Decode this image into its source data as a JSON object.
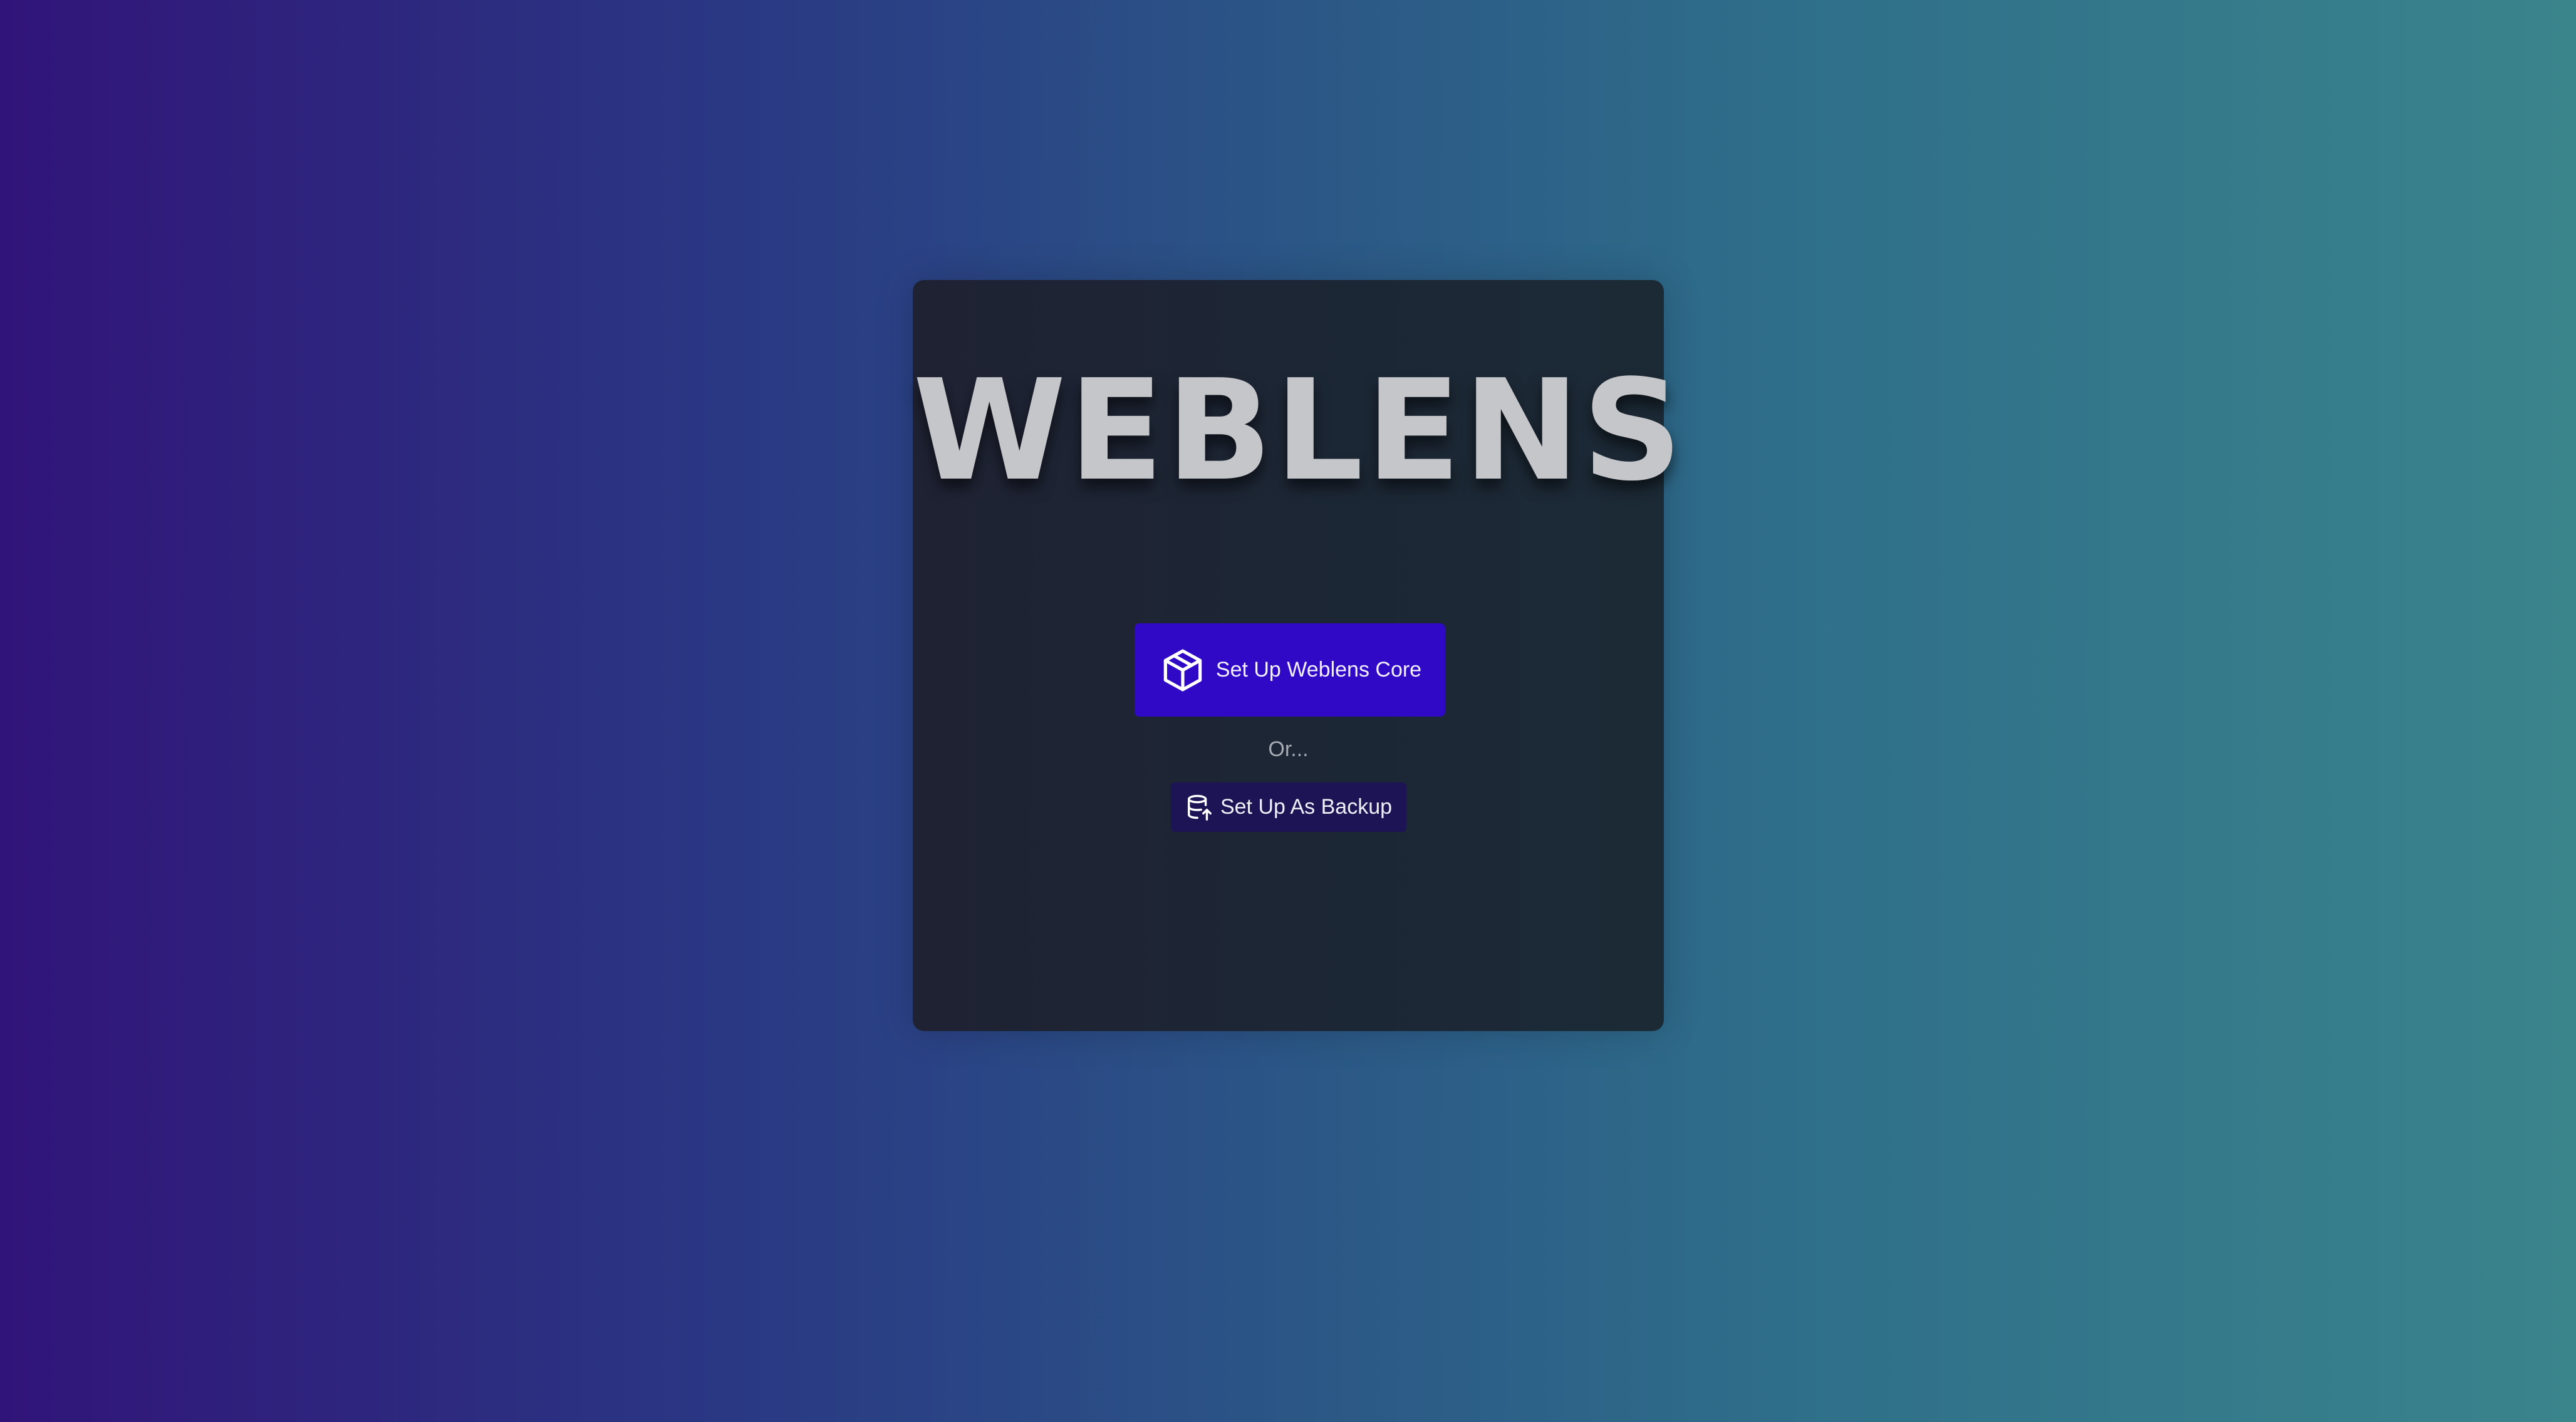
{
  "app": {
    "title": "WEBLENS"
  },
  "setup": {
    "core_button": {
      "label": "Set Up Weblens Core",
      "icon": "package-icon"
    },
    "or_label": "Or...",
    "backup_button": {
      "label": "Set Up As Backup",
      "icon": "database-upload-icon"
    }
  },
  "colors": {
    "background_start": "#311479",
    "background_end": "#3a848c",
    "card": "#1c2533",
    "title": "#c4c6ca",
    "core_button": "#3009c7",
    "backup_button": "#1d1455"
  }
}
